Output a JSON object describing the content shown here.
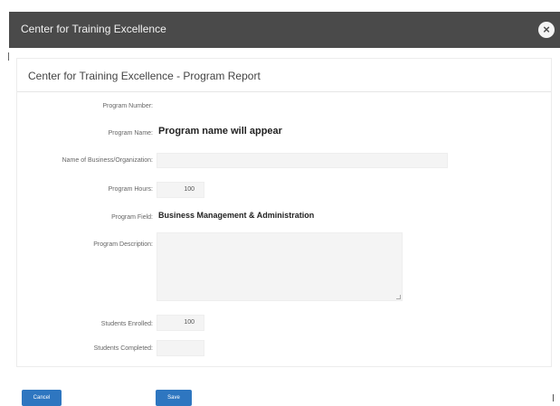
{
  "window": {
    "title": "Center for Training Excellence",
    "close_icon": "close-icon"
  },
  "panel": {
    "title": "Center for Training Excellence - Program Report"
  },
  "form": {
    "program_number": {
      "label": "Program Number:",
      "value": ""
    },
    "program_name": {
      "label": "Program Name:",
      "value": "Program name will appear"
    },
    "business_name": {
      "label": "Name of Business/Organization:",
      "value": ""
    },
    "program_hours": {
      "label": "Program Hours:",
      "value": "100"
    },
    "program_field": {
      "label": "Program Field:",
      "value": "Business Management & Administration"
    },
    "program_description": {
      "label": "Program Description:",
      "value": ""
    },
    "students_enrolled": {
      "label": "Students Enrolled:",
      "value": "100"
    },
    "students_completed": {
      "label": "Students Completed:",
      "value": ""
    }
  },
  "buttons": {
    "cancel": "Cancel",
    "save": "Save"
  },
  "colors": {
    "titlebar": "#4a4a4a",
    "button": "#2e76c0"
  }
}
